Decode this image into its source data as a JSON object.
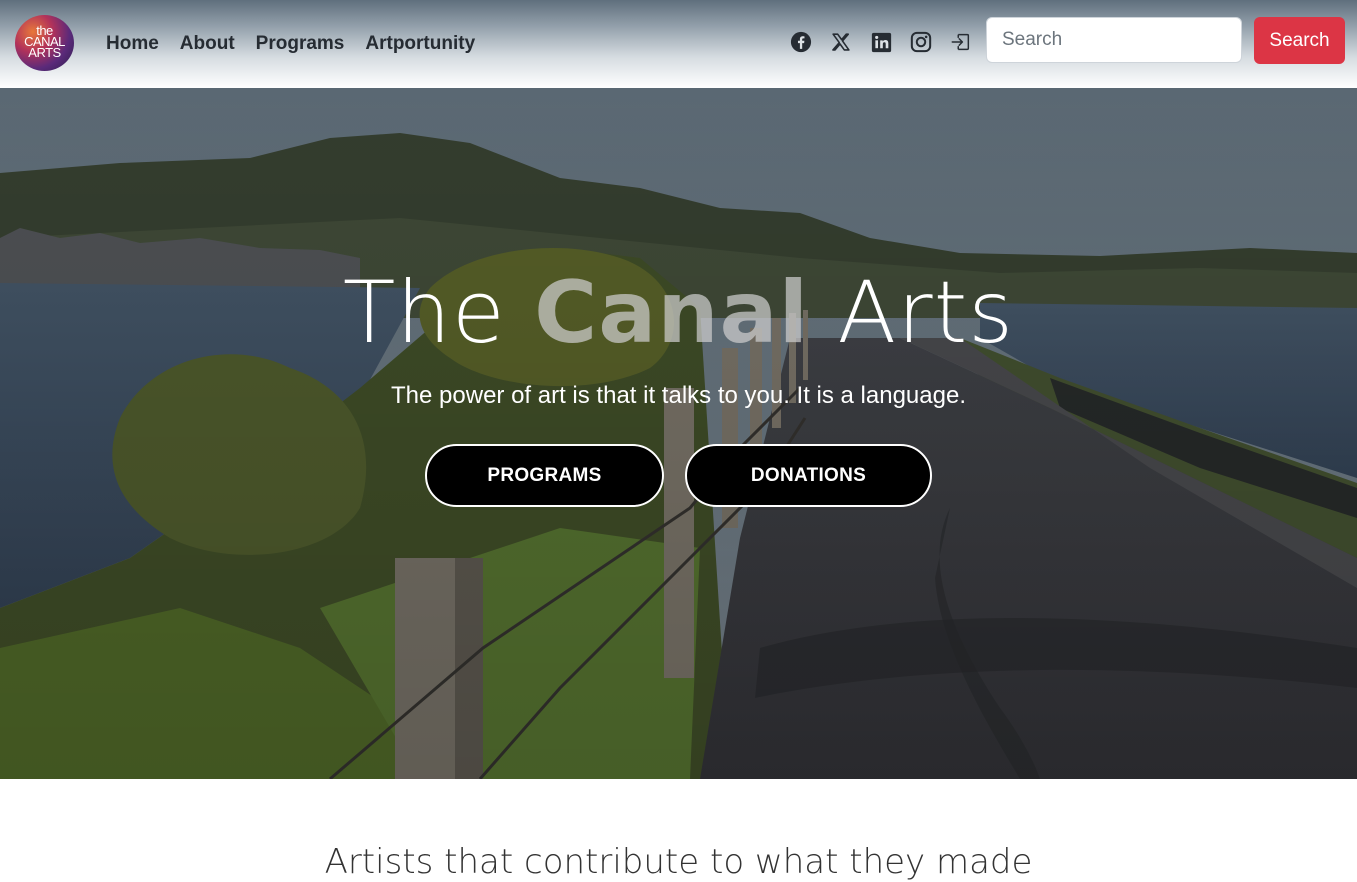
{
  "brand": {
    "logo_alt": "the CANAL ARTS",
    "logo_text": "the\nCANAL\nARTS"
  },
  "nav": {
    "links": [
      "Home",
      "About",
      "Programs",
      "Artportunity"
    ]
  },
  "social": {
    "icons": [
      "facebook-icon",
      "x-twitter-icon",
      "linkedin-icon",
      "instagram-icon",
      "login-icon"
    ]
  },
  "search": {
    "placeholder": "Search",
    "value": "",
    "button_label": "Search"
  },
  "hero": {
    "title_part1": "The ",
    "title_accent": "Canal",
    "title_part2": " Arts",
    "subtitle": "The power of art is that it talks to you. It is a language.",
    "buttons": [
      "PROGRAMS",
      "DONATIONS"
    ]
  },
  "below": {
    "text": "Artists that contribute to what they made"
  },
  "colors": {
    "accent": "#dc3545",
    "nav_text": "#262c33",
    "hero_button_bg": "#000000"
  }
}
